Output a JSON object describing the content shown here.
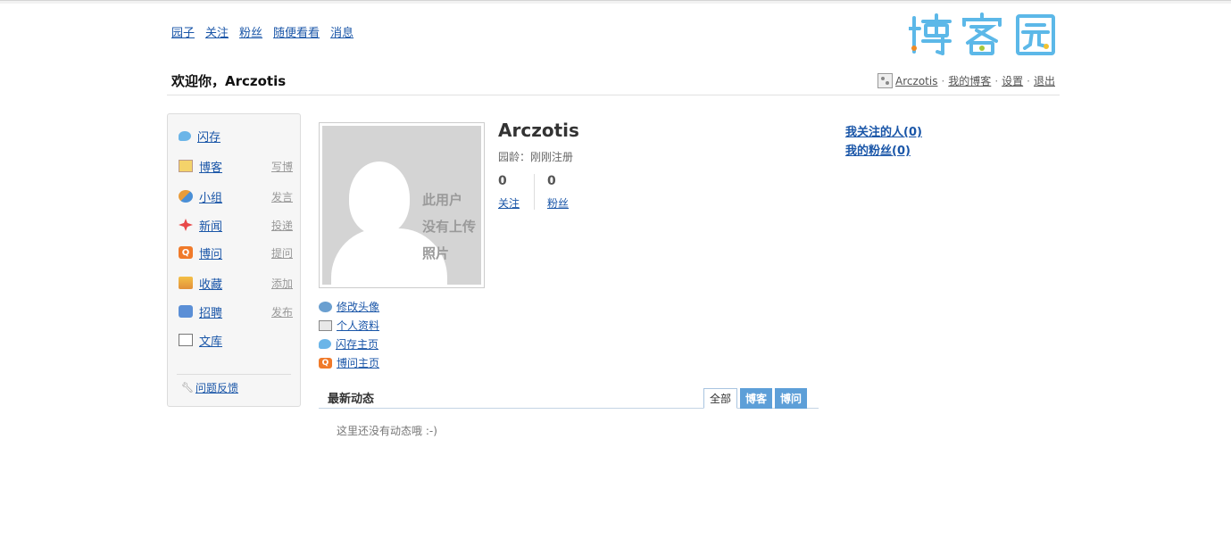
{
  "topnav": [
    "园子",
    "关注",
    "粉丝",
    "随便看看",
    "消息"
  ],
  "logo_text": "博客园",
  "welcome": "欢迎你，Arczotis",
  "userbar": {
    "username": "Arczotis",
    "my_blog": "我的博客",
    "settings": "设置",
    "logout": "退出",
    "sep": "·"
  },
  "sidebar": {
    "items": [
      {
        "label": "闪存",
        "action": "",
        "icon": "chat-bubble-icon"
      },
      {
        "label": "博客",
        "action": "写博",
        "icon": "notepad-icon"
      },
      {
        "label": "小组",
        "action": "发言",
        "icon": "group-icon"
      },
      {
        "label": "新闻",
        "action": "投递",
        "icon": "news-icon"
      },
      {
        "label": "博问",
        "action": "提问",
        "icon": "question-icon"
      },
      {
        "label": "收藏",
        "action": "添加",
        "icon": "favorites-icon"
      },
      {
        "label": "招聘",
        "action": "发布",
        "icon": "job-icon"
      },
      {
        "label": "文库",
        "action": "",
        "icon": "book-icon"
      }
    ],
    "feedback": "问题反馈"
  },
  "avatar": {
    "placeholder_line1": "此用户",
    "placeholder_line2": "没有上传",
    "placeholder_line3": "照片"
  },
  "profile_links": [
    "修改头像",
    "个人资料",
    "闪存主页",
    "博问主页"
  ],
  "profile": {
    "name": "Arczotis",
    "age": "园龄：刚刚注册",
    "following_count": "0",
    "following_label": "关注",
    "followers_count": "0",
    "followers_label": "粉丝"
  },
  "follow_box": {
    "my_following": "我关注的人(0)",
    "my_followers": "我的粉丝(0)"
  },
  "feed": {
    "title": "最新动态",
    "tabs": [
      "全部",
      "博客",
      "博问"
    ],
    "active_tab": "全部",
    "empty": "这里还没有动态哦 :-)"
  }
}
